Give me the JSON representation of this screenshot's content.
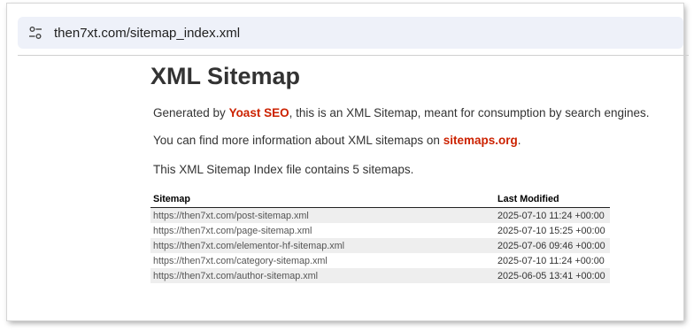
{
  "browser": {
    "url": "then7xt.com/sitemap_index.xml",
    "site_icon": "tune-icon"
  },
  "page": {
    "title": "XML Sitemap",
    "intro": {
      "prefix": "Generated by ",
      "link": "Yoast SEO",
      "suffix": ", this is an XML Sitemap, meant for consumption by search engines."
    },
    "info": {
      "prefix": "You can find more information about XML sitemaps on ",
      "link": "sitemaps.org",
      "suffix": "."
    },
    "count_text": "This XML Sitemap Index file contains 5 sitemaps.",
    "link_color": "#cc2200"
  },
  "table": {
    "headers": {
      "sitemap": "Sitemap",
      "modified": "Last Modified"
    },
    "rows": [
      {
        "url": "https://then7xt.com/post-sitemap.xml",
        "modified": "2025-07-10 11:24 +00:00"
      },
      {
        "url": "https://then7xt.com/page-sitemap.xml",
        "modified": "2025-07-10 15:25 +00:00"
      },
      {
        "url": "https://then7xt.com/elementor-hf-sitemap.xml",
        "modified": "2025-07-06 09:46 +00:00"
      },
      {
        "url": "https://then7xt.com/category-sitemap.xml",
        "modified": "2025-07-10 11:24 +00:00"
      },
      {
        "url": "https://then7xt.com/author-sitemap.xml",
        "modified": "2025-06-05 13:41 +00:00"
      }
    ]
  }
}
